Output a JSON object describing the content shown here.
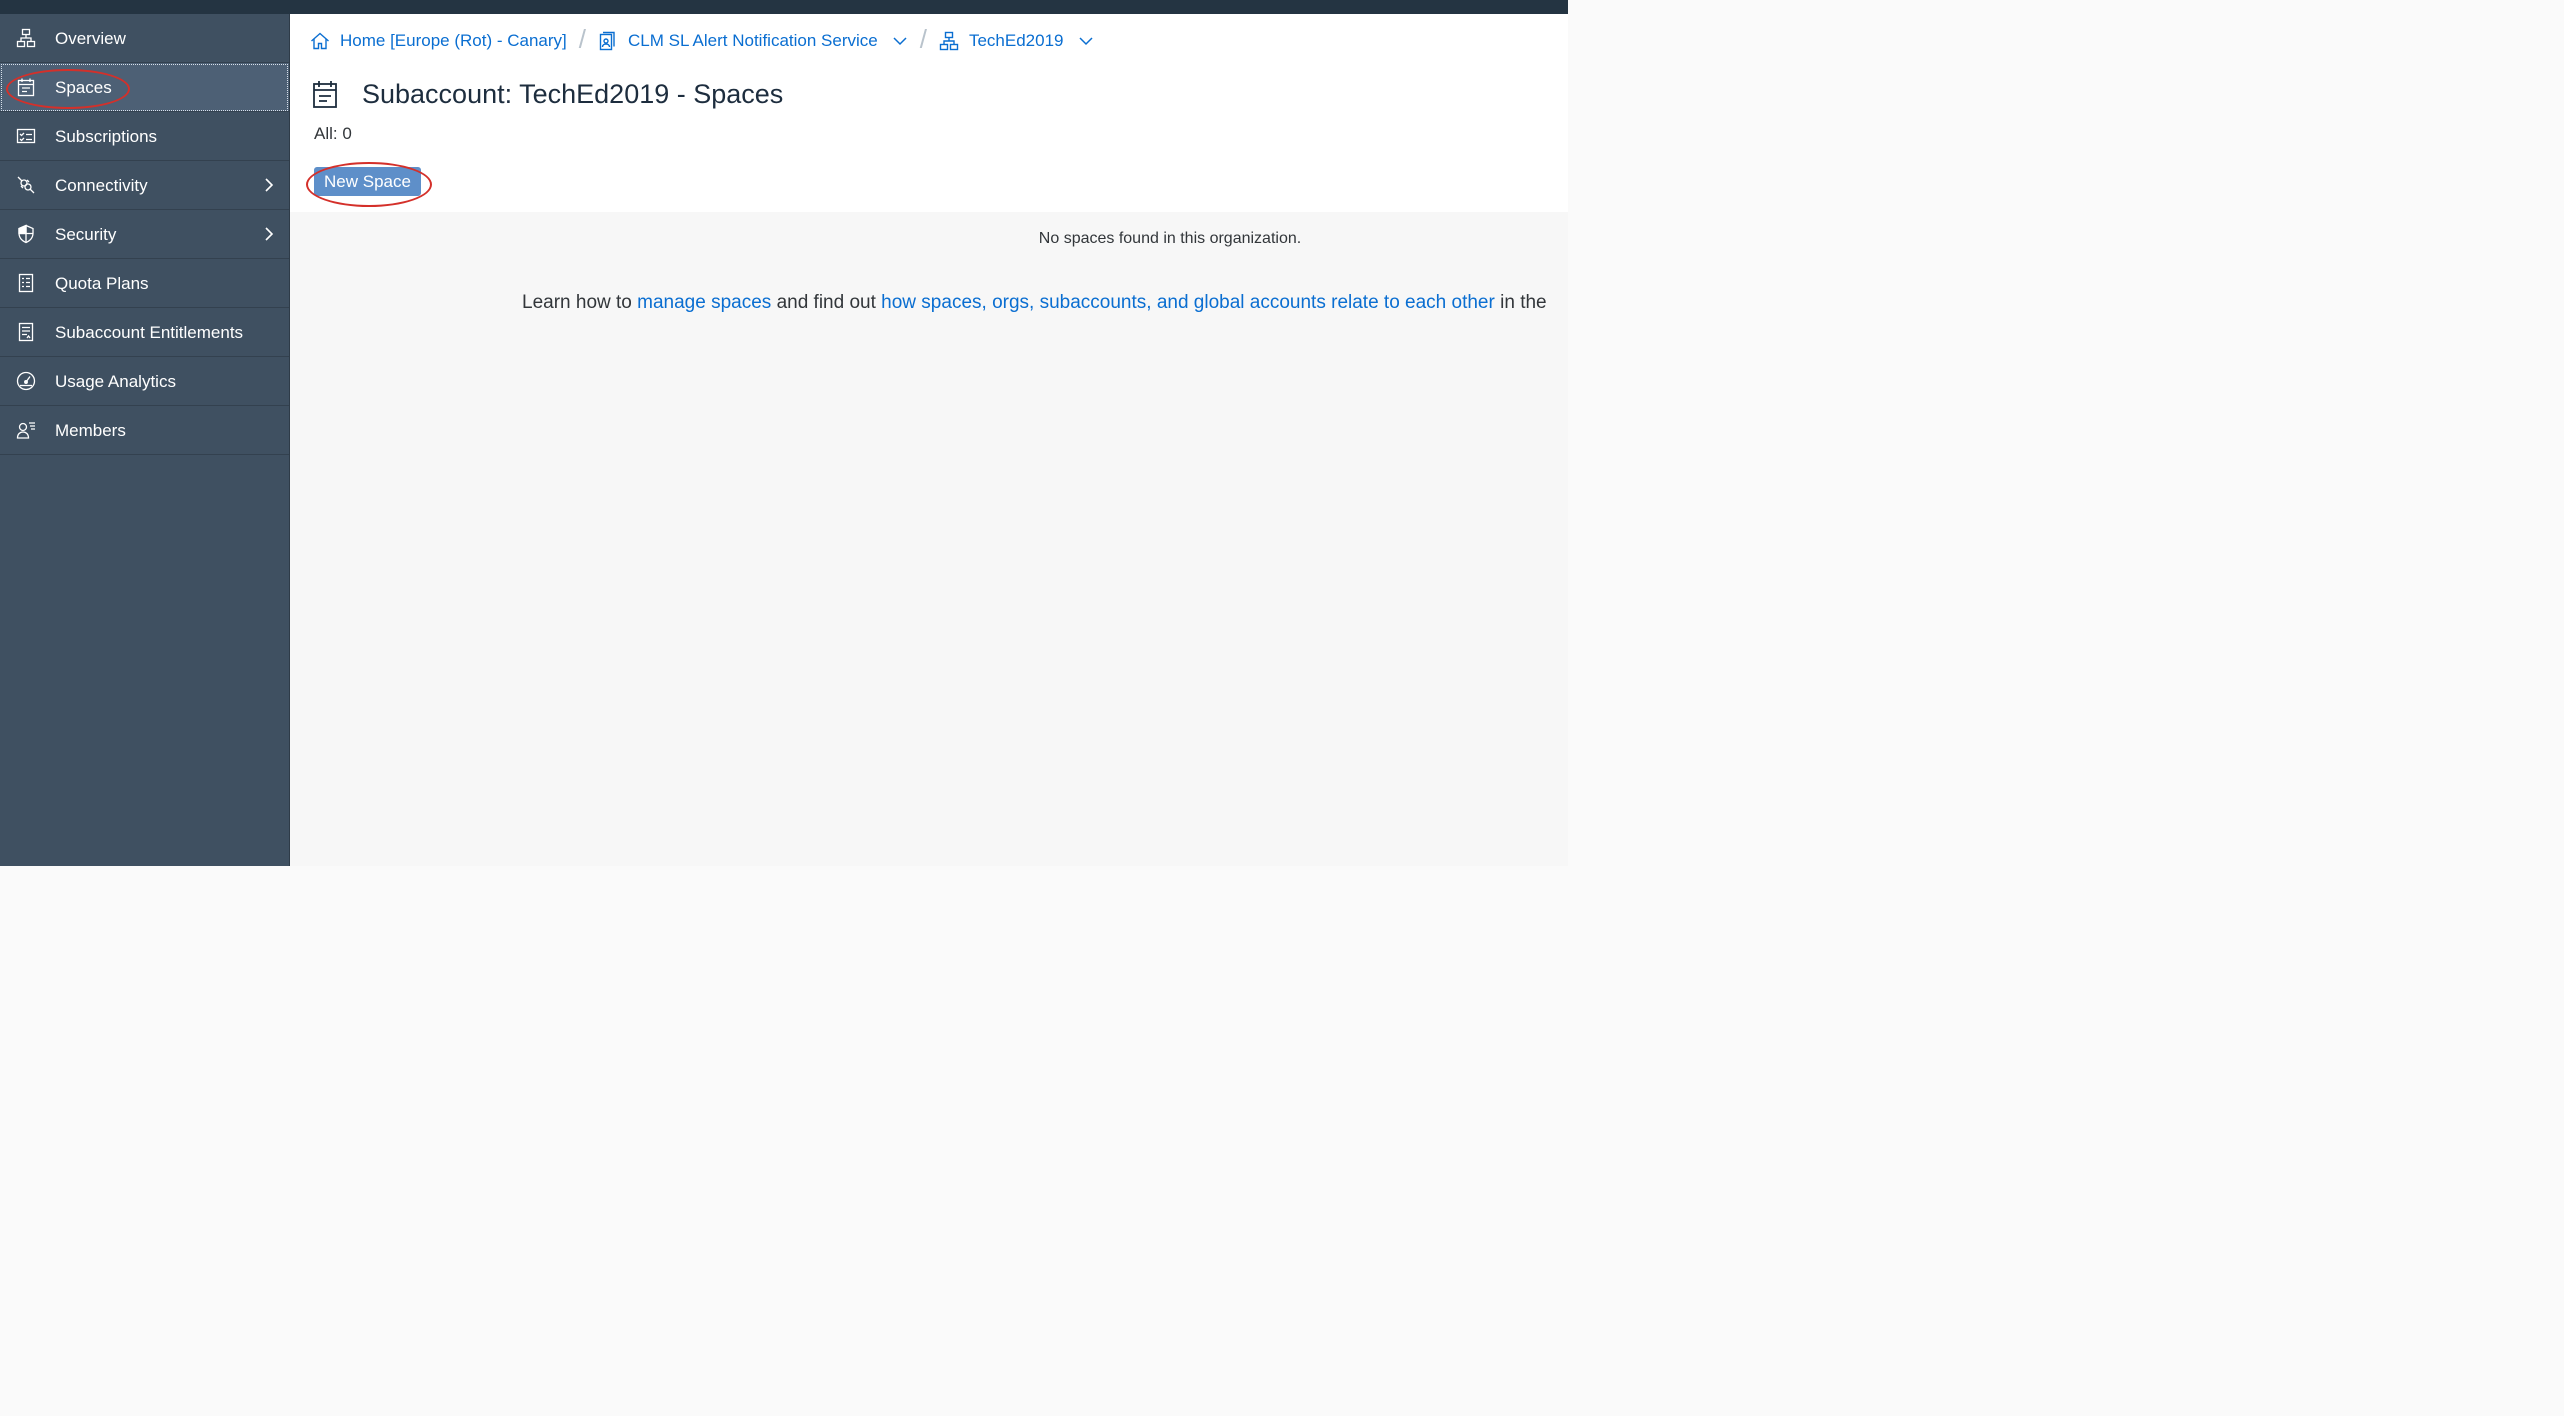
{
  "sidebar": {
    "items": [
      {
        "label": "Overview",
        "icon": "hierarchy-icon"
      },
      {
        "label": "Spaces",
        "icon": "spaces-icon",
        "selected": true
      },
      {
        "label": "Subscriptions",
        "icon": "checklist-icon"
      },
      {
        "label": "Connectivity",
        "icon": "connectivity-icon",
        "has_submenu": true
      },
      {
        "label": "Security",
        "icon": "shield-icon",
        "has_submenu": true
      },
      {
        "label": "Quota Plans",
        "icon": "quota-icon"
      },
      {
        "label": "Subaccount Entitlements",
        "icon": "entitlements-icon"
      },
      {
        "label": "Usage Analytics",
        "icon": "gauge-icon"
      },
      {
        "label": "Members",
        "icon": "members-icon"
      }
    ]
  },
  "breadcrumb": {
    "home": "Home [Europe (Rot) - Canary]",
    "global_account": "CLM SL Alert Notification Service",
    "subaccount": "TechEd2019",
    "separator": "/"
  },
  "page": {
    "title": "Subaccount: TechEd2019 - Spaces",
    "count": "All: 0",
    "new_space_label": "New Space"
  },
  "empty_state": {
    "message": "No spaces found in this organization.",
    "learn_prefix": "Learn how to ",
    "link_manage": "manage spaces",
    "learn_middle": " and find out ",
    "link_relate": "how spaces, orgs, subaccounts, and global accounts relate to each other",
    "learn_suffix": " in the"
  },
  "colors": {
    "sidebar_bg": "#3f5061",
    "sidebar_selected": "#4d6075",
    "link": "#0a6ed1",
    "button": "#5e8fc9",
    "annotation": "#d4302a"
  }
}
